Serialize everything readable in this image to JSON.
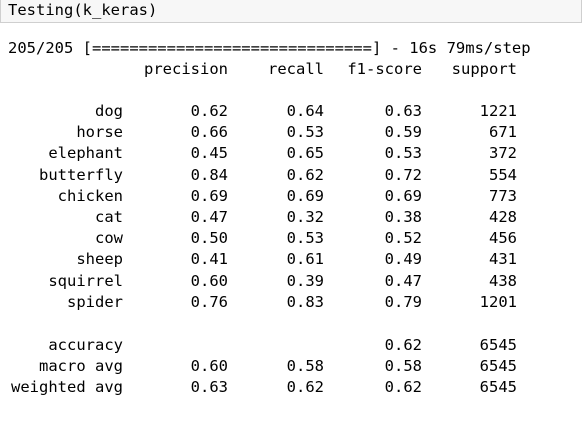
{
  "input_cell": {
    "code": "Testing(k_keras)"
  },
  "output": {
    "progress_line": "205/205 [==============================] - 16s 79ms/step",
    "headers": {
      "precision": "precision",
      "recall": "recall",
      "f1": "f1-score",
      "support": "support"
    },
    "rows": [
      {
        "label": "dog",
        "precision": "0.62",
        "recall": "0.64",
        "f1": "0.63",
        "support": "1221"
      },
      {
        "label": "horse",
        "precision": "0.66",
        "recall": "0.53",
        "f1": "0.59",
        "support": "671"
      },
      {
        "label": "elephant",
        "precision": "0.45",
        "recall": "0.65",
        "f1": "0.53",
        "support": "372"
      },
      {
        "label": "butterfly",
        "precision": "0.84",
        "recall": "0.62",
        "f1": "0.72",
        "support": "554"
      },
      {
        "label": "chicken",
        "precision": "0.69",
        "recall": "0.69",
        "f1": "0.69",
        "support": "773"
      },
      {
        "label": "cat",
        "precision": "0.47",
        "recall": "0.32",
        "f1": "0.38",
        "support": "428"
      },
      {
        "label": "cow",
        "precision": "0.50",
        "recall": "0.53",
        "f1": "0.52",
        "support": "456"
      },
      {
        "label": "sheep",
        "precision": "0.41",
        "recall": "0.61",
        "f1": "0.49",
        "support": "431"
      },
      {
        "label": "squirrel",
        "precision": "0.60",
        "recall": "0.39",
        "f1": "0.47",
        "support": "438"
      },
      {
        "label": "spider",
        "precision": "0.76",
        "recall": "0.83",
        "f1": "0.79",
        "support": "1201"
      }
    ],
    "summary": [
      {
        "label": "accuracy",
        "precision": "",
        "recall": "",
        "f1": "0.62",
        "support": "6545"
      },
      {
        "label": "macro avg",
        "precision": "0.60",
        "recall": "0.58",
        "f1": "0.58",
        "support": "6545"
      },
      {
        "label": "weighted avg",
        "precision": "0.63",
        "recall": "0.62",
        "f1": "0.62",
        "support": "6545"
      }
    ]
  }
}
